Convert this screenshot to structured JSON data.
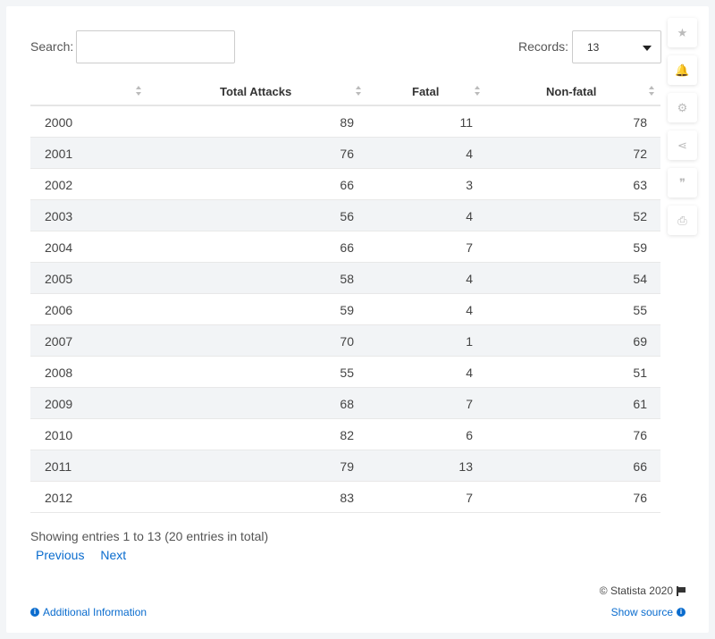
{
  "search": {
    "label": "Search:",
    "value": "",
    "placeholder": ""
  },
  "records": {
    "label": "Records:",
    "value": "13"
  },
  "tools": [
    {
      "name": "favorite",
      "icon": "star-icon",
      "glyph": "★"
    },
    {
      "name": "notifications",
      "icon": "bell-icon",
      "glyph": "🔔"
    },
    {
      "name": "settings",
      "icon": "gear-icon",
      "glyph": "⚙"
    },
    {
      "name": "share",
      "icon": "share-icon",
      "glyph": "⋖"
    },
    {
      "name": "cite",
      "icon": "quote-icon",
      "glyph": "❞"
    },
    {
      "name": "print",
      "icon": "print-icon",
      "glyph": "⎙"
    }
  ],
  "table": {
    "headers": [
      "",
      "Total Attacks",
      "Fatal",
      "Non-fatal"
    ],
    "rows": [
      [
        "2000",
        "89",
        "11",
        "78"
      ],
      [
        "2001",
        "76",
        "4",
        "72"
      ],
      [
        "2002",
        "66",
        "3",
        "63"
      ],
      [
        "2003",
        "56",
        "4",
        "52"
      ],
      [
        "2004",
        "66",
        "7",
        "59"
      ],
      [
        "2005",
        "58",
        "4",
        "54"
      ],
      [
        "2006",
        "59",
        "4",
        "55"
      ],
      [
        "2007",
        "70",
        "1",
        "69"
      ],
      [
        "2008",
        "55",
        "4",
        "51"
      ],
      [
        "2009",
        "68",
        "7",
        "61"
      ],
      [
        "2010",
        "82",
        "6",
        "76"
      ],
      [
        "2011",
        "79",
        "13",
        "66"
      ],
      [
        "2012",
        "83",
        "7",
        "76"
      ]
    ]
  },
  "footer": {
    "showing": "Showing entries 1 to 13 (20 entries in total)",
    "previous": "Previous",
    "next": "Next",
    "copyright": "© Statista 2020",
    "additional_info": "Additional Information",
    "show_source": "Show source"
  },
  "colors": {
    "link": "#0a6cce",
    "row_alt": "#f2f4f6"
  }
}
